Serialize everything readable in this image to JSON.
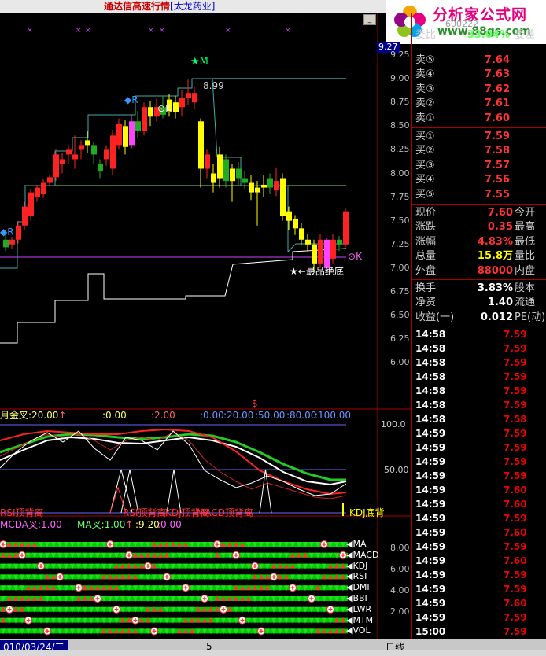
{
  "window": {
    "title": "通达信高速行情",
    "stock_name": "[太龙药业]"
  },
  "logo": {
    "main": "分析家公式网",
    "url": "www.88gs.com"
  },
  "header_partial": {
    "code": "600222",
    "ratio_label": "委比",
    "ratio_value": "33.04%",
    "diff_label": "委差"
  },
  "main_chart": {
    "price_axis": [
      "9.25",
      "9.00",
      "8.75",
      "8.50",
      "8.25",
      "8.00",
      "7.75",
      "7.50",
      "7.25",
      "7.00",
      "6.75",
      "6.50",
      "6.25",
      "6.00"
    ],
    "current_price_tag": "9.27",
    "high_label": "8.99",
    "markers": {
      "m": "M",
      "r1": "R",
      "r2": "R",
      "k1": "K",
      "k2": "K",
      "bottom_text": "最品绝底"
    },
    "crosses": [
      "×",
      "×",
      "×",
      "×",
      "×",
      "×",
      "×"
    ]
  },
  "indicator_panel": {
    "header": "月金叉:20.00",
    "header_values": [
      ":0.00",
      ":2.00",
      ":0.00",
      ":20.00",
      ":50.00",
      ":80.00",
      ":100.00"
    ],
    "dollar": "$",
    "axis": [
      "100.0",
      "50.00"
    ],
    "signals": [
      "RSI顶背离",
      "RSI顶背离",
      "KDJ顶背离",
      "MACD顶背离"
    ],
    "tail_label": "KDJ底背"
  },
  "signal_panel": {
    "header": "MCDA叉:1.00",
    "ma_label": "MA叉:1.00",
    "ma_values": ":9.20",
    "ma_values2": ":0.00",
    "axis": [
      "8.00",
      "6.00",
      "4.00",
      "2.00"
    ],
    "rows": [
      "MA",
      "MACD",
      "KDJ",
      "RSI",
      "DMI",
      "BBI",
      "LWR",
      "MTM",
      "VOL"
    ]
  },
  "order_book": {
    "sells": [
      {
        "label": "卖⑤",
        "price": "7.64"
      },
      {
        "label": "卖④",
        "price": "7.63"
      },
      {
        "label": "卖③",
        "price": "7.62"
      },
      {
        "label": "卖②",
        "price": "7.61"
      },
      {
        "label": "卖①",
        "price": "7.60"
      }
    ],
    "buys": [
      {
        "label": "买①",
        "price": "7.59"
      },
      {
        "label": "买②",
        "price": "7.58"
      },
      {
        "label": "买③",
        "price": "7.57"
      },
      {
        "label": "买④",
        "price": "7.56"
      },
      {
        "label": "买⑤",
        "price": "7.55"
      }
    ]
  },
  "quote": [
    {
      "label": "现价",
      "value": "7.60",
      "label2": "今开",
      "color": "#ff3333"
    },
    {
      "label": "涨跌",
      "value": "0.35",
      "label2": "最高",
      "color": "#ff3333"
    },
    {
      "label": "涨幅",
      "value": "4.83%",
      "label2": "最低",
      "color": "#ff3333"
    },
    {
      "label": "总量",
      "value": "15.8万",
      "label2": "量比",
      "color": "#ffff00"
    },
    {
      "label": "外盘",
      "value": "88000",
      "label2": "内盘",
      "color": "#ff3333"
    }
  ],
  "stats": [
    {
      "label": "换手",
      "value": "3.83%",
      "label2": "股本",
      "color": "#ffffff"
    },
    {
      "label": "净资",
      "value": "1.40",
      "label2": "流通",
      "color": "#ffffff"
    },
    {
      "label": "收益(一)",
      "value": "0.012",
      "label2": "PE(动)",
      "color": "#ffffff"
    }
  ],
  "ticks": [
    {
      "time": "14:58",
      "price": "7.59"
    },
    {
      "time": "14:58",
      "price": "7.59"
    },
    {
      "time": "14:58",
      "price": "7.59"
    },
    {
      "time": "14:58",
      "price": "7.59"
    },
    {
      "time": "14:58",
      "price": "7.59"
    },
    {
      "time": "14:58",
      "price": "7.59"
    },
    {
      "time": "14:58",
      "price": "7.58"
    },
    {
      "time": "14:59",
      "price": "7.59"
    },
    {
      "time": "14:59",
      "price": "7.59"
    },
    {
      "time": "14:59",
      "price": "7.59"
    },
    {
      "time": "14:59",
      "price": "7.59"
    },
    {
      "time": "14:59",
      "price": "7.60"
    },
    {
      "time": "14:59",
      "price": "7.60"
    },
    {
      "time": "14:59",
      "price": "7.59"
    },
    {
      "time": "14:59",
      "price": "7.60"
    },
    {
      "time": "14:59",
      "price": "7.59"
    },
    {
      "time": "14:59",
      "price": "7.60"
    },
    {
      "time": "14:59",
      "price": "7.59"
    },
    {
      "time": "14:59",
      "price": "7.59"
    },
    {
      "time": "14:59",
      "price": "7.60"
    },
    {
      "time": "14:59",
      "price": "7.59"
    },
    {
      "time": "15:00",
      "price": "7.59"
    },
    {
      "time": "15:00",
      "price": "7.59"
    }
  ],
  "status": {
    "date": "010/03/24/三",
    "mid_marker": "5",
    "period": "日线"
  },
  "colors": {
    "up": "#ff3333",
    "down": "#00ffff",
    "yellow": "#ffff00",
    "green": "#00cc00",
    "magenta": "#ff00ff"
  }
}
